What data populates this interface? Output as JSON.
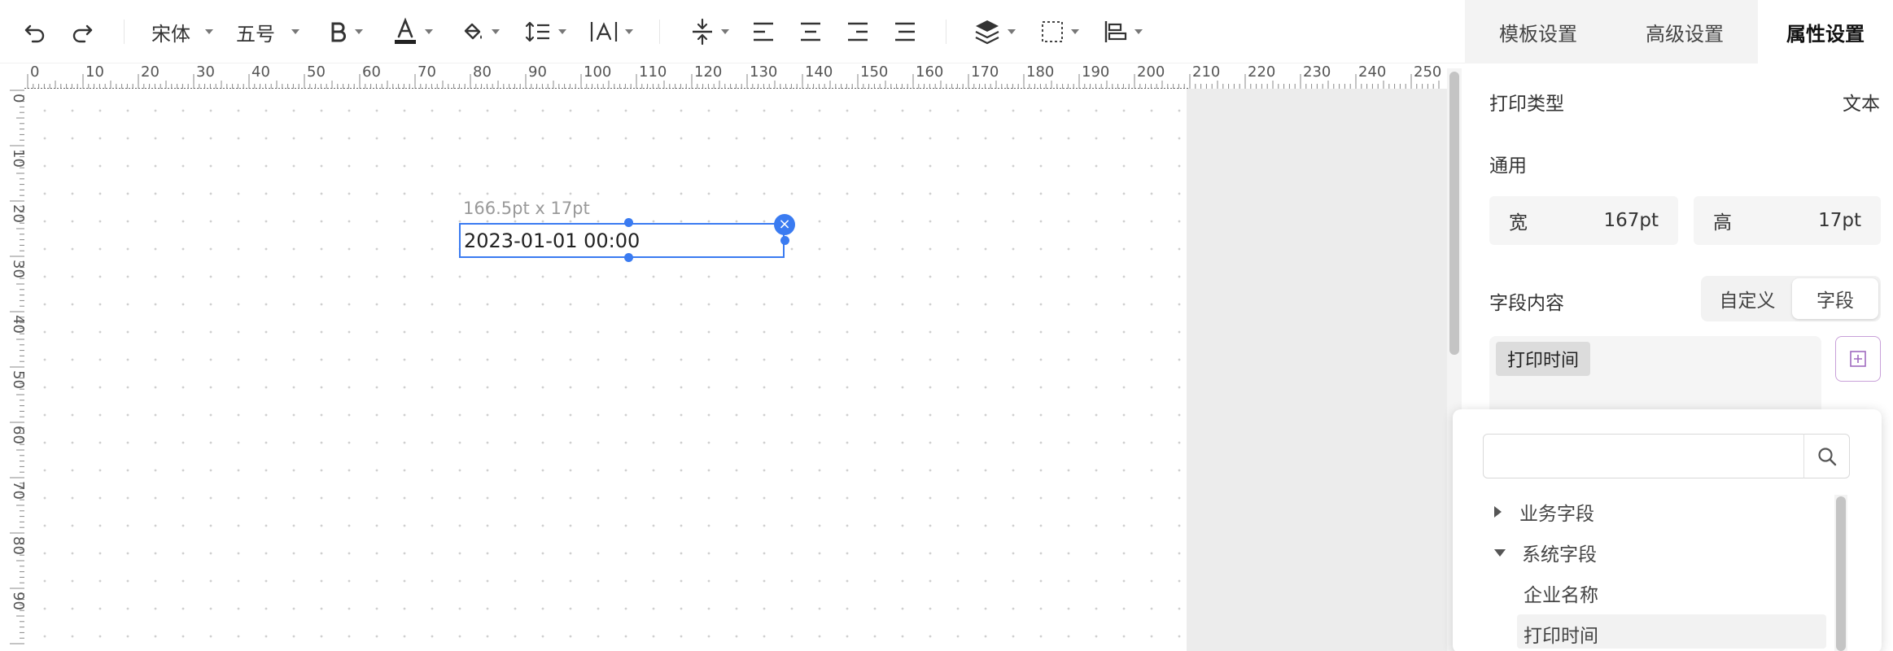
{
  "toolbar": {
    "font_family": "宋体",
    "font_size": "五号"
  },
  "ruler": {
    "h_labels": [
      "0",
      "10",
      "20",
      "30",
      "40",
      "50",
      "60",
      "70",
      "80",
      "90",
      "100",
      "110",
      "120",
      "130",
      "140",
      "150",
      "160",
      "170",
      "180",
      "190",
      "200",
      "210",
      "220",
      "230",
      "240",
      "250"
    ],
    "v_labels": [
      "0",
      "10",
      "20",
      "30",
      "40",
      "50",
      "60",
      "70",
      "80",
      "90"
    ]
  },
  "canvas": {
    "selection_size": "166.5pt x 17pt",
    "element_text": "2023-01-01 00:00"
  },
  "panel": {
    "tabs": [
      "模板设置",
      "高级设置",
      "属性设置"
    ],
    "print_type_label": "打印类型",
    "print_type_value": "文本",
    "general_label": "通用",
    "width_label": "宽",
    "width_value": "167pt",
    "height_label": "高",
    "height_value": "17pt",
    "field_content_label": "字段内容",
    "segment": [
      "自定义",
      "字段"
    ],
    "selected_field_chip": "打印时间"
  },
  "dropdown": {
    "search_placeholder": "",
    "tree": [
      {
        "label": "业务字段",
        "expanded": false
      },
      {
        "label": "系统字段",
        "expanded": true,
        "children": [
          "企业名称",
          "打印时间"
        ]
      }
    ]
  },
  "colors": {
    "accent": "#3a7bf1",
    "add_border": "#c8a0d8"
  }
}
